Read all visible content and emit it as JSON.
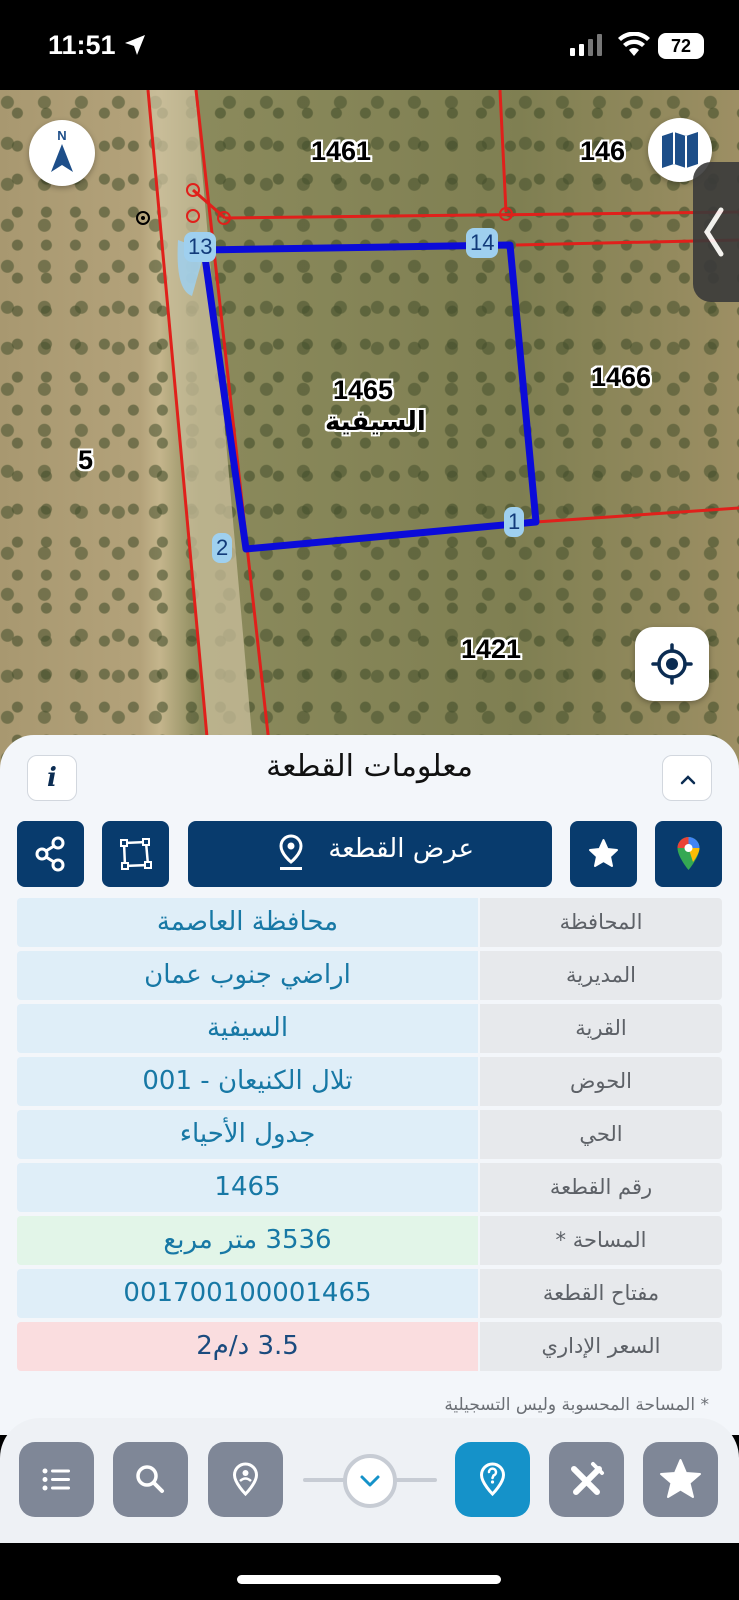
{
  "status": {
    "time": "11:51",
    "battery": "72"
  },
  "map": {
    "compass_letter": "N",
    "parcel_labels": [
      "1461",
      "146",
      "1466",
      "1465",
      "5",
      "1421"
    ],
    "selected_parcel": {
      "number": "1465",
      "village": "السيفية"
    },
    "vertices": [
      "13",
      "14",
      "1",
      "2"
    ],
    "colors": {
      "boundary": "#e0201b",
      "selected": "#0b0bd9"
    }
  },
  "sheet": {
    "title": "معلومات القطعة",
    "info_icon": "i",
    "show_parcel_label": "عرض القطعة",
    "rows": [
      {
        "label": "المحافظة",
        "value": "محافظة العاصمة",
        "style": "blue"
      },
      {
        "label": "المديرية",
        "value": "اراضي جنوب عمان",
        "style": "blue"
      },
      {
        "label": "القرية",
        "value": "السيفية",
        "style": "blue"
      },
      {
        "label": "الحوض",
        "value": "تلال الكنيعان - 001",
        "style": "blue"
      },
      {
        "label": "الحي",
        "value": "جدول الأحياء",
        "style": "blue"
      },
      {
        "label": "رقم القطعة",
        "value": "1465",
        "style": "blue"
      },
      {
        "label": "المساحة *",
        "value": "3536  متر مربع",
        "style": "green"
      },
      {
        "label": "مفتاح القطعة",
        "value": "001700100001465",
        "style": "blue"
      },
      {
        "label": "السعر الإداري",
        "value": "3.5 د/م2",
        "style": "red"
      }
    ],
    "note": "* المساحة المحسوبة وليس التسجيلية"
  },
  "accent": {
    "navy": "#083b6d",
    "teal": "#1592c9",
    "gray": "#7f8797"
  }
}
